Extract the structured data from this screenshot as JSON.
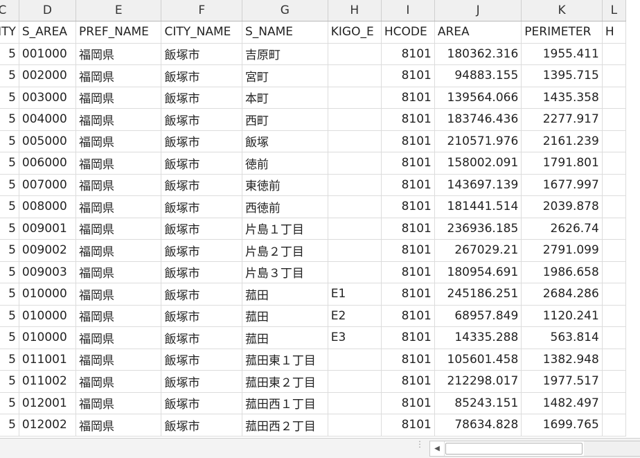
{
  "columns": [
    "C",
    "D",
    "E",
    "F",
    "G",
    "H",
    "I",
    "J",
    "K",
    "L"
  ],
  "headers": [
    "CITY",
    "S_AREA",
    "PREF_NAME",
    "CITY_NAME",
    "S_NAME",
    "KIGO_E",
    "HCODE",
    "AREA",
    "PERIMETER",
    "H"
  ],
  "rows": [
    [
      "5",
      "001000",
      "福岡県",
      "飯塚市",
      "吉原町",
      "",
      "8101",
      "180362.316",
      "1955.411",
      ""
    ],
    [
      "5",
      "002000",
      "福岡県",
      "飯塚市",
      "宮町",
      "",
      "8101",
      "94883.155",
      "1395.715",
      ""
    ],
    [
      "5",
      "003000",
      "福岡県",
      "飯塚市",
      "本町",
      "",
      "8101",
      "139564.066",
      "1435.358",
      ""
    ],
    [
      "5",
      "004000",
      "福岡県",
      "飯塚市",
      "西町",
      "",
      "8101",
      "183746.436",
      "2277.917",
      ""
    ],
    [
      "5",
      "005000",
      "福岡県",
      "飯塚市",
      "飯塚",
      "",
      "8101",
      "210571.976",
      "2161.239",
      ""
    ],
    [
      "5",
      "006000",
      "福岡県",
      "飯塚市",
      "徳前",
      "",
      "8101",
      "158002.091",
      "1791.801",
      ""
    ],
    [
      "5",
      "007000",
      "福岡県",
      "飯塚市",
      "東徳前",
      "",
      "8101",
      "143697.139",
      "1677.997",
      ""
    ],
    [
      "5",
      "008000",
      "福岡県",
      "飯塚市",
      "西徳前",
      "",
      "8101",
      "181441.514",
      "2039.878",
      ""
    ],
    [
      "5",
      "009001",
      "福岡県",
      "飯塚市",
      "片島１丁目",
      "",
      "8101",
      "236936.185",
      "2626.74",
      ""
    ],
    [
      "5",
      "009002",
      "福岡県",
      "飯塚市",
      "片島２丁目",
      "",
      "8101",
      "267029.21",
      "2791.099",
      ""
    ],
    [
      "5",
      "009003",
      "福岡県",
      "飯塚市",
      "片島３丁目",
      "",
      "8101",
      "180954.691",
      "1986.658",
      ""
    ],
    [
      "5",
      "010000",
      "福岡県",
      "飯塚市",
      "菰田",
      "E1",
      "8101",
      "245186.251",
      "2684.286",
      ""
    ],
    [
      "5",
      "010000",
      "福岡県",
      "飯塚市",
      "菰田",
      "E2",
      "8101",
      "68957.849",
      "1120.241",
      ""
    ],
    [
      "5",
      "010000",
      "福岡県",
      "飯塚市",
      "菰田",
      "E3",
      "8101",
      "14335.288",
      "563.814",
      ""
    ],
    [
      "5",
      "011001",
      "福岡県",
      "飯塚市",
      "菰田東１丁目",
      "",
      "8101",
      "105601.458",
      "1382.948",
      ""
    ],
    [
      "5",
      "011002",
      "福岡県",
      "飯塚市",
      "菰田東２丁目",
      "",
      "8101",
      "212298.017",
      "1977.517",
      ""
    ],
    [
      "5",
      "012001",
      "福岡県",
      "飯塚市",
      "菰田西１丁目",
      "",
      "8101",
      "85243.151",
      "1482.497",
      ""
    ],
    [
      "5",
      "012002",
      "福岡県",
      "飯塚市",
      "菰田西２丁目",
      "",
      "8101",
      "78634.828",
      "1699.765",
      ""
    ]
  ]
}
